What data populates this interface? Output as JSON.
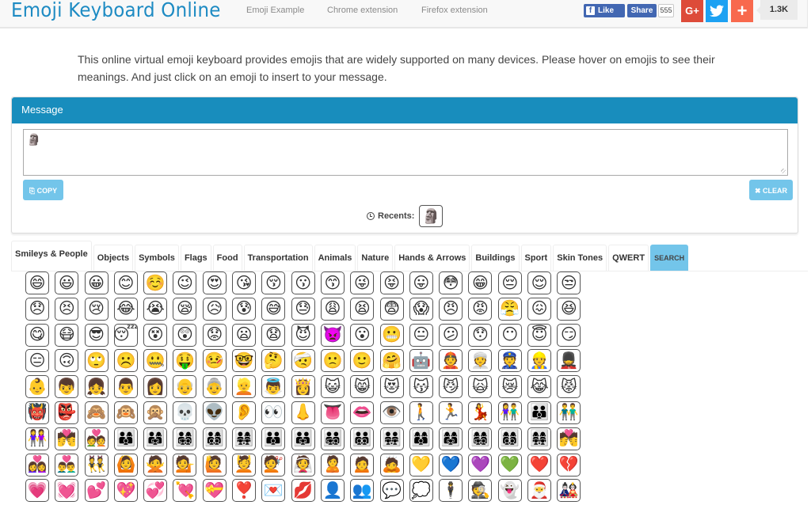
{
  "header": {
    "brand": "Emoji Keyboard Online",
    "nav": [
      "Emoji Example",
      "Chrome extension",
      "Firefox extension"
    ],
    "facebook": {
      "like_label": "Like",
      "share_label": "Share",
      "count": "555",
      "icon": "f"
    },
    "social": {
      "gplus_label": "G+",
      "twitter_icon": "🐦",
      "addthis_label": "+",
      "total_shares": "1.3K"
    },
    "colors": {
      "brand": "#1e8bc3",
      "facebook": "#4267b2",
      "gplus": "#dd4b39",
      "twitter": "#1da1f2",
      "addthis": "#f8694d"
    }
  },
  "intro": "This online virtual emoji keyboard provides emojis that are widely supported on many devices. Please hover on emojis to see their meanings. And just click on an emoji to insert to your message.",
  "message_panel": {
    "title": "Message",
    "message_value": "🗿",
    "copy_label": "COPY",
    "copy_icon": "⎘",
    "clear_label": "CLEAR",
    "clear_icon": "✖",
    "recents_label": "Recents:",
    "recents": [
      "🗿"
    ],
    "colors": {
      "heading": "#188dbd",
      "button": "#73c5ea"
    }
  },
  "tabs": [
    {
      "label": "Smileys & People",
      "active": true
    },
    {
      "label": "Objects"
    },
    {
      "label": "Symbols"
    },
    {
      "label": "Flags"
    },
    {
      "label": "Food"
    },
    {
      "label": "Transportation"
    },
    {
      "label": "Animals"
    },
    {
      "label": "Nature"
    },
    {
      "label": "Hands & Arrows"
    },
    {
      "label": "Buildings"
    },
    {
      "label": "Sport"
    },
    {
      "label": "Skin Tones"
    },
    {
      "label": "QWERT"
    },
    {
      "label": "SEARCH",
      "search": true
    }
  ],
  "emoji_rows": [
    [
      "😄",
      "😃",
      "😀",
      "😊",
      "☺️",
      "😉",
      "😍",
      "😘",
      "😚",
      "😗",
      "😙",
      "😜",
      "😝",
      "😛",
      "😳",
      "😁",
      "😔",
      "😌",
      "😒"
    ],
    [
      "😞",
      "😣",
      "😢",
      "😂",
      "😭",
      "😪",
      "😥",
      "😰",
      "😅",
      "😓",
      "😩",
      "😫",
      "😨",
      "😱",
      "😠",
      "😡",
      "😤",
      "😖",
      "😆"
    ],
    [
      "😋",
      "😷",
      "😎",
      "😴",
      "😵",
      "😲",
      "😟",
      "😦",
      "😧",
      "😈",
      "👿",
      "😮",
      "😬",
      "😐",
      "😕",
      "😯",
      "😶",
      "😇",
      "😏"
    ],
    [
      "😑",
      "🙃",
      "🙄",
      "☹️",
      "🤐",
      "🤑",
      "🤒",
      "🤓",
      "🤔",
      "🤕",
      "🙁",
      "🙂",
      "🤗",
      "🤖",
      "👲",
      "👳",
      "👮",
      "👷",
      "💂"
    ],
    [
      "👶",
      "👦",
      "👧",
      "👨",
      "👩",
      "👴",
      "👵",
      "👱",
      "👼",
      "👸",
      "😺",
      "😸",
      "😻",
      "😽",
      "😼",
      "🙀",
      "😿",
      "😹",
      "😾"
    ],
    [
      "👹",
      "👺",
      "🙈",
      "🙉",
      "🙊",
      "💀",
      "👽",
      "👂",
      "👀",
      "👃",
      "👅",
      "👄",
      "👁️",
      "🚶",
      "🏃",
      "💃",
      "👫",
      "👪",
      "👬"
    ],
    [
      "👭",
      "💏",
      "💑",
      "👨‍👩‍👦",
      "👨‍👩‍👧",
      "👨‍👩‍👧‍👦",
      "👨‍👩‍👦‍👦",
      "👨‍👩‍👧‍👧",
      "👨‍👨‍👦",
      "👨‍👨‍👧",
      "👨‍👨‍👧‍👦",
      "👨‍👨‍👦‍👦",
      "👨‍👨‍👧‍👧",
      "👩‍👩‍👦",
      "👩‍👩‍👧",
      "👩‍👩‍👧‍👦",
      "👩‍👩‍👦‍👦",
      "👩‍👩‍👧‍👧",
      "💏"
    ],
    [
      "👩‍❤️‍👩",
      "👨‍❤️‍👨",
      "👯",
      "🙆",
      "🙅",
      "💁",
      "🙋",
      "💆",
      "💇",
      "👰",
      "🙎",
      "🙍",
      "🙇",
      "💛",
      "💙",
      "💜",
      "💚",
      "❤️",
      "💔"
    ],
    [
      "💗",
      "💓",
      "💕",
      "💖",
      "💞",
      "💘",
      "💝",
      "❣️",
      "💌",
      "💋",
      "👤",
      "👥",
      "💬",
      "💭",
      "🕴️",
      "🕵️",
      "👻",
      "🎅",
      "🎎"
    ]
  ]
}
